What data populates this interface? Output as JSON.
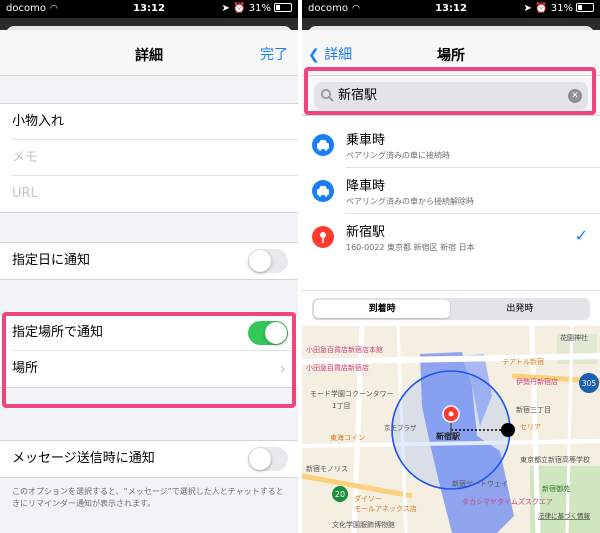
{
  "status_bar": {
    "carrier": "docomo",
    "time": "13:12",
    "battery": "31%"
  },
  "details_screen": {
    "title": "詳細",
    "done_label": "完了",
    "fields": {
      "title_value": "小物入れ",
      "notes_placeholder": "メモ",
      "url_placeholder": "URL"
    },
    "notify_on_day_label": "指定日に通知",
    "notify_at_location_label": "指定場所で通知",
    "location_label": "場所",
    "notify_when_messaging_label": "メッセージ送信時に通知",
    "footnote": "このオプションを選択すると、“メッセージ”で選択した人とチャットするときにリマインダー通知が表示されます。",
    "toggles": {
      "notify_on_day": false,
      "notify_at_location": true,
      "notify_when_messaging": false
    }
  },
  "location_screen": {
    "back_label": "詳細",
    "title": "場所",
    "search_value": "新宿駅",
    "results": [
      {
        "title": "乗車時",
        "subtitle": "ペアリング済みの車に接続時",
        "icon": "car-icon"
      },
      {
        "title": "降車時",
        "subtitle": "ペアリング済みの車から接続解除時",
        "icon": "car-icon"
      },
      {
        "title": "新宿駅",
        "subtitle": "160-0022 東京都 新宿区 新宿 日本",
        "icon": "pin-icon",
        "selected": true
      }
    ],
    "segments": [
      "到着時",
      "出発時"
    ],
    "selected_segment": 0,
    "map": {
      "labels": {
        "l1": "小田急百貨店新宿店本館",
        "l2": "小田急百貨店新宿店",
        "l3": "モード学園コクーンタワー",
        "l4": "東海コイン",
        "l5": "新宿モノリス",
        "l6": "ダイソー",
        "l7": "京王プラザ",
        "l8": "新宿駅",
        "l9": "テアトル新宿",
        "l10": "伊勢丹新宿店",
        "l11": "新宿三丁目",
        "l12": "セリア",
        "l13": "東京都立新宿高等学校",
        "l14": "新宿御苑",
        "l15": "新宿ゲートウェイ",
        "l16": "文化学園服飾博物館",
        "l17": "法律に基づく情報",
        "l18": "タカシマヤタイムズスクエア",
        "l19": "花園神社",
        "l20": "1丁目",
        "l21": "2丁目",
        "l22": "モールアネックス店",
        "l23": "ダイソー"
      },
      "route_shields": [
        "20",
        "305"
      ]
    }
  },
  "colors": {
    "accent": "#1a7ef7",
    "toggle_on": "#34c759",
    "highlight": "#f0457a",
    "pin": "#ff3b30"
  }
}
